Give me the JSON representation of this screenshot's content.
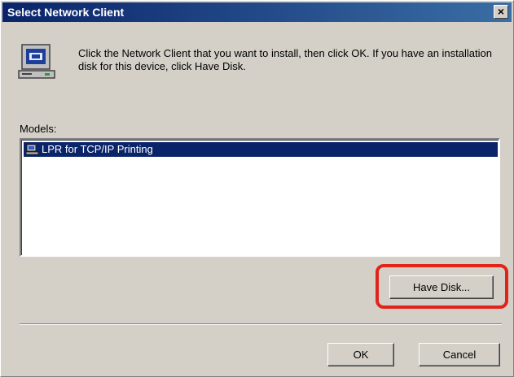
{
  "window": {
    "title": "Select Network Client",
    "close_label": "×"
  },
  "instructions": "Click the Network Client that you want to install, then click OK. If you have an installation disk for this device, click Have Disk.",
  "models": {
    "label": "Models:",
    "items": [
      {
        "label": "LPR for TCP/IP Printing",
        "selected": true
      }
    ]
  },
  "buttons": {
    "have_disk": "Have Disk...",
    "ok": "OK",
    "cancel": "Cancel"
  },
  "colors": {
    "titlebar": "#0a246a",
    "selection": "#0a246a",
    "highlight": "#e2231a",
    "face": "#d4d0c8"
  }
}
